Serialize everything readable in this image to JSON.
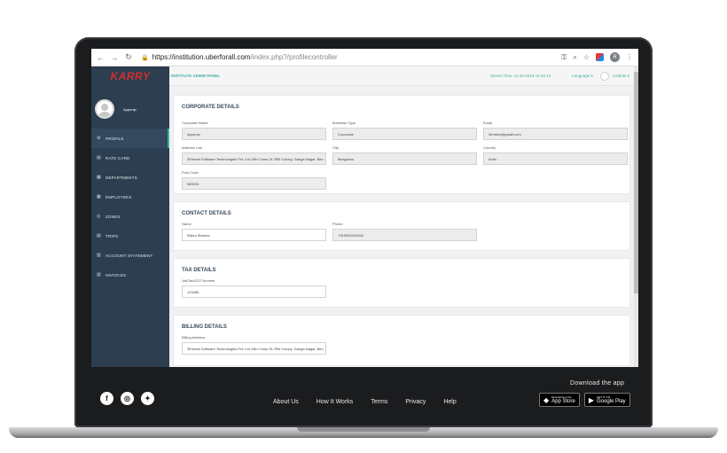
{
  "browser": {
    "url_host": "https://institution.uberforall.com",
    "url_path": "/index.php?/profilecontroller",
    "profile_initial": "R"
  },
  "sidebar": {
    "logo": "KARRY",
    "user_name": "Appenip",
    "items": [
      {
        "label": "PROFILE",
        "icon": "gear-icon",
        "glyph": "⚙"
      },
      {
        "label": "RATE CARD",
        "icon": "card-icon",
        "glyph": "▤"
      },
      {
        "label": "DEPARTMENTS",
        "icon": "building-icon",
        "glyph": "▦"
      },
      {
        "label": "EMPLOYEES",
        "icon": "users-icon",
        "glyph": "▦"
      },
      {
        "label": "ZONES",
        "icon": "globe-icon",
        "glyph": "◎"
      },
      {
        "label": "TRIPS",
        "icon": "route-icon",
        "glyph": "▤"
      },
      {
        "label": "ACCOUNT STATEMENT",
        "icon": "document-icon",
        "glyph": "▥"
      },
      {
        "label": "INVOICES",
        "icon": "invoice-icon",
        "glyph": "▥"
      }
    ]
  },
  "header": {
    "panel_title": "INSTITUTE ADMIN PANEL",
    "server_time": "Server Time: 11-10-2018 14:34:13",
    "language": "Language ▾",
    "institute": "Institute ▾"
  },
  "corporate": {
    "title": "CORPORATE DETAILS",
    "company_name_label": "Corporate Name",
    "company_name": "Appenip",
    "business_type_label": "Business Type",
    "business_type": "Corporate",
    "email_label": "Email",
    "email": "3embed@gmail.com",
    "address_label": "Address Line",
    "address": "3Embed Software Technologies Pvt. Ltd.10th Cross St, RBI Colony, Ganga Nagar, Ben",
    "city_label": "City",
    "city": "Bengaluru",
    "country_label": "Country",
    "country": "India",
    "post_code_label": "Post Code",
    "post_code": "560024"
  },
  "contact": {
    "title": "CONTACT DETAILS",
    "name_label": "Name",
    "name": "Rahul Sharma",
    "phone_label": "Phone",
    "phone": "+919902016342"
  },
  "tax": {
    "title": "TAX DETAILS",
    "number_label": "Vat/Tax/GST Number",
    "number": "123456"
  },
  "billing": {
    "title": "BILLING DETAILS",
    "address_label": "Billing Address",
    "address": "3Embed Software Technologies Pvt. Ltd.10th Cross St, RBI Colony, Ganga Nagar, Ben"
  },
  "footer": {
    "links": [
      "About Us",
      "How It Works",
      "Terms",
      "Privacy",
      "Help"
    ],
    "download_title": "Download the app",
    "app_store_small": "Download on the",
    "app_store_big": "App Store",
    "google_play_small": "GET IT ON",
    "google_play_big": "Google Play"
  }
}
